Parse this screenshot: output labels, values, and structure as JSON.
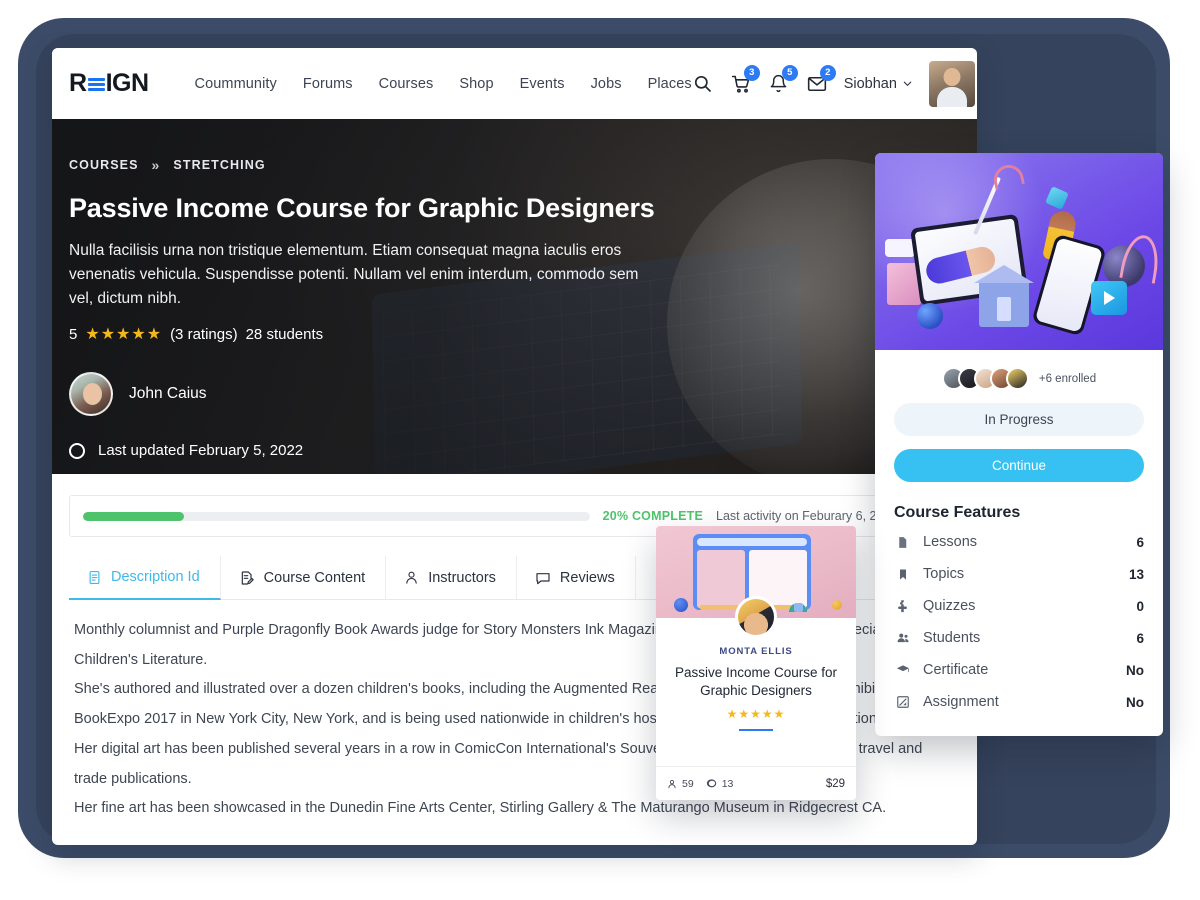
{
  "header": {
    "logo_text": "REIGN",
    "nav": [
      {
        "label": "Coummunity"
      },
      {
        "label": "Forums"
      },
      {
        "label": "Courses"
      },
      {
        "label": "Shop"
      },
      {
        "label": "Events"
      },
      {
        "label": "Jobs"
      },
      {
        "label": "Places"
      }
    ],
    "cart_badge": "3",
    "bell_badge": "5",
    "mail_badge": "2",
    "username": "Siobhan"
  },
  "hero": {
    "breadcrumb_root": "COURSES",
    "breadcrumb_sep": "»",
    "breadcrumb_current": "STRETCHING",
    "title": "Passive Income Course for Graphic Designers",
    "description": "Nulla facilisis urna non tristique elementum. Etiam consequat magna iaculis eros venenatis vehicula. Suspendisse potenti. Nullam vel enim interdum, commodo sem vel, dictum nibh.",
    "rating_value": "5",
    "stars": "★★★★★",
    "ratings_count": "(3 ratings)",
    "students": "28 students",
    "instructor_name": "John Caius",
    "last_updated": "Last updated February 5, 2022"
  },
  "progress": {
    "percent_label": "20% COMPLETE",
    "percent_value": 20,
    "last_activity": "Last activity on Feburary 6, 2022 5:58 am"
  },
  "tabs": [
    {
      "label": "Description Id",
      "icon": "document-icon",
      "active": true
    },
    {
      "label": "Course Content",
      "icon": "edit-document-icon",
      "active": false
    },
    {
      "label": "Instructors",
      "icon": "person-icon",
      "active": false
    },
    {
      "label": "Reviews",
      "icon": "comment-icon",
      "active": false
    }
  ],
  "description_paragraphs": [
    "Monthly columnist and Purple Dragonfly Book Awards judge for Story Monsters Ink Magazine since 2017, a publication specializing in Children's Literature.",
    "She's authored and illustrated over a dozen children's books, including the Augmented Reality enhanced Sleep Sweet, exhibited at BookExpo 2017 in New York City, New York, and is being used nationwide in children's hospitals for relaxation and distraction therapy.",
    "Her digital art has been published several years in a row in ComicCon International's Souvenir Book, Art 278, and multiple travel and trade publications.",
    "Her fine art has been showcased in the Dunedin Fine Arts Center, Stirling Gallery & The Maturango Museum in Ridgecrest CA."
  ],
  "sidebar": {
    "enrolled_text": "+6 enrolled",
    "status_button": "In Progress",
    "primary_button": "Continue",
    "features_title": "Course Features",
    "features": [
      {
        "icon": "file-icon",
        "label": "Lessons",
        "value": "6"
      },
      {
        "icon": "bookmark-icon",
        "label": "Topics",
        "value": "13"
      },
      {
        "icon": "puzzle-icon",
        "label": "Quizzes",
        "value": "0"
      },
      {
        "icon": "people-icon",
        "label": "Students",
        "value": "6"
      },
      {
        "icon": "graduation-cap-icon",
        "label": "Certificate",
        "value": "No"
      },
      {
        "icon": "pencil-square-icon",
        "label": "Assignment",
        "value": "No"
      }
    ]
  },
  "course_card": {
    "author": "MONTA ELLIS",
    "title": "Passive Income Course for Graphic Designers",
    "stars": "★★★★★",
    "students": "59",
    "comments": "13",
    "price": "$29"
  },
  "colors": {
    "frame_outer": "#3c4c68",
    "frame_inner": "#36435c",
    "accent_blue": "#2d7bf4",
    "accent_cyan": "#37c0f2",
    "progress_green": "#4fc36b",
    "star_gold": "#f5b81c",
    "sidebar_hero_purple": "#6b47e6",
    "card_thumb_pink": "#eab9c8"
  }
}
